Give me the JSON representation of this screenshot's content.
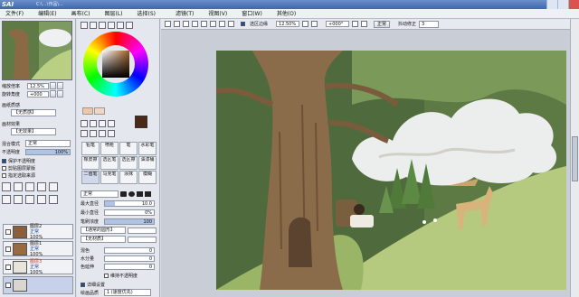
{
  "window": {
    "logo": "SAI",
    "title": "C:\\...\\作品\\..."
  },
  "menu": [
    "文件(F)",
    "编辑(E)",
    "画布(C)",
    "图层(L)",
    "选择(S)",
    "滤镜(T)",
    "视图(V)",
    "窗口(W)",
    "其他(O)"
  ],
  "navigator": {
    "zoom_label": "缩放倍率",
    "zoom_value": "12.5%",
    "angle_label": "旋转角度",
    "angle_value": "+000"
  },
  "layer_props": {
    "texture_label": "画纸质感",
    "texture_value": "【无质感】",
    "effect_label": "画材效果",
    "effect_value": "【无效果】",
    "blend_label": "混合模式",
    "blend_value": "正常",
    "opacity_label": "不透明度",
    "opacity_value": "100%",
    "opt_preserve": "保护不透明度",
    "opt_clip": "剪贴图层蒙版",
    "opt_select": "指定选取来源"
  },
  "layers": [
    {
      "name": "图层2",
      "mode": "正常",
      "opacity": "100%"
    },
    {
      "name": "图层1",
      "mode": "正常",
      "opacity": "100%"
    },
    {
      "name": "图层3",
      "mode": "正常",
      "opacity": "100%"
    }
  ],
  "tools": {
    "row1": [
      "铅笔",
      "喷枪",
      "笔",
      "水彩笔"
    ],
    "row2": [
      "橡皮擦",
      "选区笔",
      "选区擦",
      "油漆桶"
    ],
    "row3": [
      "二值笔",
      "马克笔",
      "涂抹",
      "模糊"
    ],
    "mode_value": "正常",
    "max_diam_label": "最大直径",
    "max_diam_value": "10.0",
    "min_diam_label": "最小直径",
    "min_diam_value": "0%",
    "density_label": "笔刷浓度",
    "density_value": "100",
    "shape_value": "【通常的圆形】",
    "texture_value": "【无材质】",
    "blend_label": "混色",
    "blend_value": "0",
    "dilution_label": "水分量",
    "dilution_value": "0",
    "persist_label": "色延伸",
    "persist_value": "0",
    "keep_opacity_label": "维持不透明度",
    "detail_label": "详细设置",
    "quality_label": "绘画品质",
    "quality_value": "1 (速度优先)"
  },
  "canvas_toolbar": {
    "stabilizer_label": "选区边缘",
    "zoom_value": "12.50%",
    "angle_value": "+000°",
    "normal_label": "正常",
    "shake_label": "抖动修正",
    "shake_value": "3"
  },
  "colors": {
    "primary": "#4a2a16",
    "secondary": "#ffffff"
  }
}
